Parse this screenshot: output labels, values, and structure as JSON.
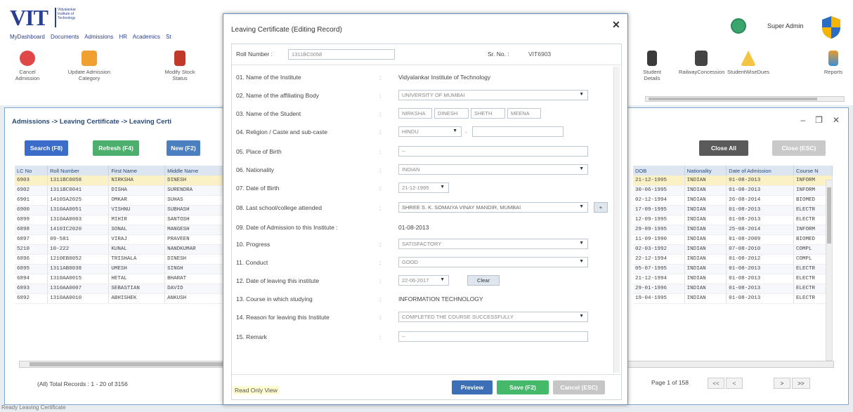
{
  "header": {
    "logo_text": "VIT",
    "logo_sub": "Vidyalankar Institute of Technology",
    "menu": [
      "MyDashboard",
      "Documents",
      "Admissions",
      "HR",
      "Academics",
      "St"
    ],
    "ribbon_left": [
      {
        "label": "Cancel Admission",
        "icon": "cancel-icon"
      },
      {
        "label": "Update Admission Category",
        "icon": "category-icon"
      },
      {
        "label": "Modify Stock Status",
        "icon": "modify-icon"
      }
    ],
    "ribbon_right": [
      {
        "label": "Student Details",
        "icon": "student-icon"
      },
      {
        "label": "RailwayConcession",
        "icon": "railway-icon"
      },
      {
        "label": "StudentWiseDues",
        "icon": "dues-icon"
      },
      {
        "label": "Reports",
        "icon": "reports-icon"
      }
    ],
    "user": "Super Admin"
  },
  "window": {
    "breadcrumb": "Admissions -> Leaving Certificate -> Leaving Certi",
    "buttons": {
      "search": "Search (F8)",
      "refresh": "Refresh (F4)",
      "new": "New (F2)",
      "close_all": "Close All",
      "close_esc": "Close (ESC)"
    },
    "left_columns": [
      "LC No",
      "Roll Number",
      "First Name",
      "Middle Name"
    ],
    "left_rows": [
      [
        "6903",
        "1311BC0058",
        "NIRKSHA",
        "DINESH"
      ],
      [
        "6902",
        "1311BC0041",
        "DISHA",
        "SURENDRA"
      ],
      [
        "6901",
        "1410SA2025",
        "OMKAR",
        "SUHAS"
      ],
      [
        "6900",
        "1310AA0051",
        "VISHNU",
        "SUBHASH"
      ],
      [
        "6899",
        "1310AA0003",
        "MIHIR",
        "SANTOSH"
      ],
      [
        "6898",
        "1410IC2020",
        "SONAL",
        "MANGESH"
      ],
      [
        "6897",
        "09-581",
        "VIRAJ",
        "PRAVEEN"
      ],
      [
        "5210",
        "10-222",
        "KUNAL",
        "NANDKUMAR"
      ],
      [
        "6896",
        "1210EB0052",
        "TRISHALA",
        "DINESH"
      ],
      [
        "6895",
        "1311AB0038",
        "UMESH",
        "SINGH"
      ],
      [
        "6894",
        "1310AA0015",
        "HETAL",
        "BHARAT"
      ],
      [
        "6893",
        "1310AA0007",
        "SEBASTIAN",
        "DAVID"
      ],
      [
        "6892",
        "1310AA0010",
        "ABHISHEK",
        "ANKUSH"
      ]
    ],
    "right_columns": [
      "DOB",
      "Nationality",
      "Date of Admission",
      "Course N"
    ],
    "right_rows": [
      [
        "21-12-1995",
        "INDIAN",
        "01-08-2013",
        "INFORM"
      ],
      [
        "30-06-1995",
        "INDIAN",
        "01-08-2013",
        "INFORM"
      ],
      [
        "02-12-1994",
        "INDIAN",
        "26-08-2014",
        "BIOMED"
      ],
      [
        "17-09-1995",
        "INDIAN",
        "01-08-2013",
        "ELECTR"
      ],
      [
        "12-09-1995",
        "INDIAN",
        "01-08-2013",
        "ELECTR"
      ],
      [
        "29-09-1995",
        "INDIAN",
        "25-08-2014",
        "INFORM"
      ],
      [
        "11-09-1990",
        "INDIAN",
        "01-08-2009",
        "BIOMED"
      ],
      [
        "02-03-1992",
        "INDIAN",
        "07-08-2010",
        "COMPL"
      ],
      [
        "22-12-1994",
        "INDIAN",
        "01-08-2012",
        "COMPL"
      ],
      [
        "05-07-1995",
        "INDIAN",
        "01-08-2013",
        "ELECTR"
      ],
      [
        "21-12-1994",
        "INDIAN",
        "01-08-2013",
        "ELECTR"
      ],
      [
        "29-01-1996",
        "INDIAN",
        "01-08-2013",
        "ELECTR"
      ],
      [
        "19-04-1995",
        "INDIAN",
        "01-08-2013",
        "ELECTR"
      ]
    ],
    "total_records": "(All) Total Records : 1 - 20 of 3156",
    "page_info": "Page 1 of 158",
    "pager": {
      "first": "<<",
      "prev": "<",
      ">": ">",
      ">>": ">>"
    }
  },
  "dialog": {
    "title": "Leaving Certificate (Editing Record)",
    "roll_label": "Roll Number :",
    "roll_value": "1311BC0058",
    "srno_label": "Sr. No. :",
    "srno_value": "VIT6903",
    "rows": [
      {
        "label": "01.  Name of the Institute",
        "value": "Vidyalankar Institute of Technology"
      },
      {
        "label": "02. Name of the affiliating Body",
        "value": "UNIVERSITY OF MUMBAI"
      },
      {
        "label": "03. Name of the Student",
        "values": [
          "NIRKSHA",
          "DINESH",
          "SHETH",
          "MEENA"
        ]
      },
      {
        "label": "04. Religion / Caste and sub-caste",
        "value": "HINDU",
        "extra": "-"
      },
      {
        "label": "05. Place of Birth",
        "value": "--"
      },
      {
        "label": "06. Nationality",
        "value": "INDIAN"
      },
      {
        "label": "07. Date of Birth",
        "value": "21-12-1995"
      },
      {
        "label": "08. Last school/college attended",
        "value": "SHREE S. K. SOMAIYA VINAY MANDIR, MUMBAI",
        "add": "+"
      },
      {
        "label": "09. Date of Admission to this Institute :",
        "value": "01-08-2013"
      },
      {
        "label": "10. Progress",
        "value": "SATISFACTORY"
      },
      {
        "label": "11. Conduct",
        "value": "GOOD"
      },
      {
        "label": "12. Date of leaving this institute",
        "value": "22-06-2017",
        "clear": "Clear"
      },
      {
        "label": "13. Course in which studying",
        "value": "INFORMATION TECHNOLOGY"
      },
      {
        "label": "14. Reason for leaving this Institute",
        "value": "COMPLETED THE COURSE SUCCESSFULLY"
      },
      {
        "label": "15. Remark",
        "value": "--"
      }
    ],
    "buttons": {
      "preview": "Preview",
      "save": "Save (F2)",
      "cancel": "Cancel (ESC)"
    },
    "readonly": "Read Only View"
  },
  "status_bar": "Ready  Leaving Certificate",
  "colors": {
    "search": "#3b6cc9",
    "refresh": "#4caf6d",
    "new": "#4c7fc0",
    "save": "#45b86a",
    "preview": "#3c6fb5",
    "cancel": "#c6c6c6",
    "close_all": "#5a5a5a",
    "close_esc": "#c9c9c9"
  }
}
